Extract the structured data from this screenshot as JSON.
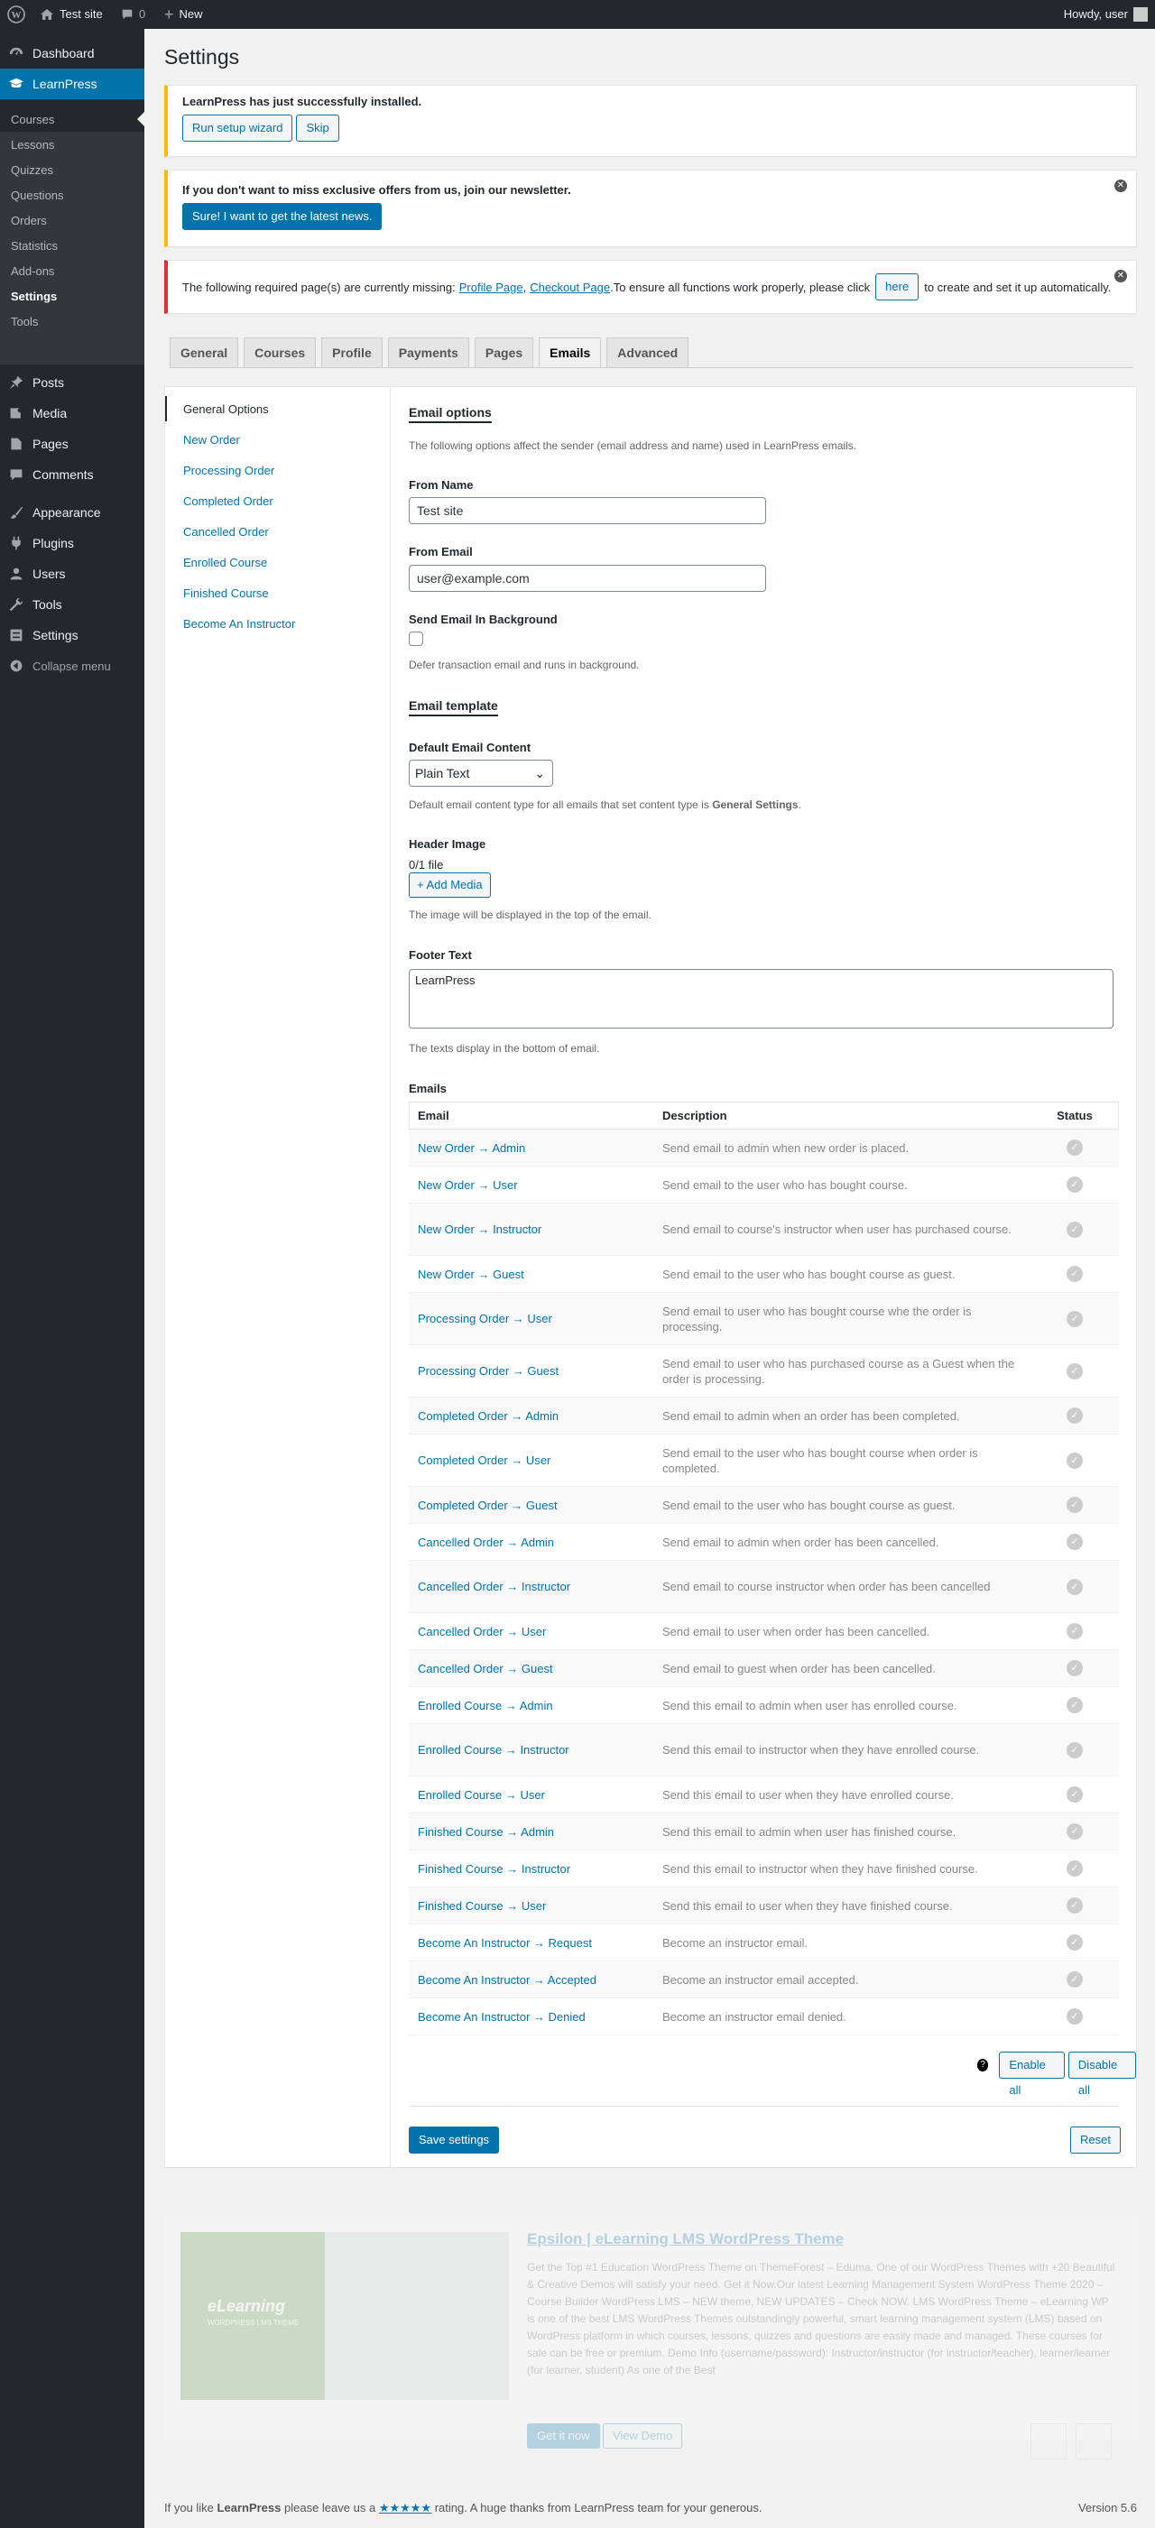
{
  "adminbar": {
    "site": "Test site",
    "comments": "0",
    "new": "New",
    "howdy": "Howdy, user"
  },
  "sidebar": {
    "top": [
      {
        "label": "Dashboard",
        "icon": "dashboard-icon"
      },
      {
        "label": "LearnPress",
        "icon": "learnpress-icon"
      }
    ],
    "learnpress_sub": [
      "Courses",
      "Lessons",
      "Quizzes",
      "Questions",
      "Orders",
      "Statistics",
      "Add-ons",
      "Settings",
      "Tools"
    ],
    "items": [
      {
        "label": "Posts",
        "icon": "pin-icon"
      },
      {
        "label": "Media",
        "icon": "media-icon"
      },
      {
        "label": "Pages",
        "icon": "page-icon"
      },
      {
        "label": "Comments",
        "icon": "comment-icon"
      },
      {
        "label": "Appearance",
        "icon": "brush-icon"
      },
      {
        "label": "Plugins",
        "icon": "plug-icon"
      },
      {
        "label": "Users",
        "icon": "user-icon"
      },
      {
        "label": "Tools",
        "icon": "wrench-icon"
      },
      {
        "label": "Settings",
        "icon": "settings-icon"
      },
      {
        "label": "Collapse menu",
        "icon": "collapse-icon"
      }
    ]
  },
  "page_title": "Settings",
  "notices": {
    "installed": {
      "text": "LearnPress has just successfully installed.",
      "btn1": "Run setup wizard",
      "btn2": "Skip"
    },
    "newsletter": {
      "text": "If you don't want to miss exclusive offers from us, join our newsletter.",
      "btn": "Sure! I want to get the latest news."
    },
    "missing": {
      "pre": "The following required page(s) are currently missing:",
      "link1": "Profile Page",
      "sep": ",",
      "link2": "Checkout Page",
      "mid": ".To ensure all functions work properly, please click",
      "btn": "here",
      "post": "to create and set it up automatically."
    }
  },
  "tabs": [
    "General",
    "Courses",
    "Profile",
    "Payments",
    "Pages",
    "Emails",
    "Advanced"
  ],
  "subnav": [
    "General Options",
    "New Order",
    "Processing Order",
    "Completed Order",
    "Cancelled Order",
    "Enrolled Course",
    "Finished Course",
    "Become An Instructor"
  ],
  "email_options": {
    "heading": "Email options",
    "desc": "The following options affect the sender (email address and name) used in LearnPress emails.",
    "from_name_label": "From Name",
    "from_name": "Test site",
    "from_email_label": "From Email",
    "from_email": "user@example.com",
    "bg_label": "Send Email In Background",
    "bg_desc": "Defer transaction email and runs in background."
  },
  "email_template": {
    "heading": "Email template",
    "content_label": "Default Email Content",
    "content_value": "Plain Text",
    "content_desc_pre": "Default email content type for all emails that set content type is",
    "content_desc_strong": "General Settings",
    "content_desc_post": ".",
    "header_label": "Header Image",
    "header_count": "0/1 file",
    "add_media": "+ Add Media",
    "header_desc": "The image will be displayed in the top of the email.",
    "footer_label": "Footer Text",
    "footer_value": "LearnPress",
    "footer_desc": "The texts display in the bottom of email."
  },
  "emails": {
    "label": "Emails",
    "columns": [
      "Email",
      "Description",
      "Status"
    ],
    "rows": [
      {
        "name": "New Order → Admin",
        "desc": "Send email to admin when new order is placed."
      },
      {
        "name": "New Order → User",
        "desc": "Send email to the user who has bought course."
      },
      {
        "name": "New Order → Instructor",
        "desc": "Send email to course's instructor when user has purchased course."
      },
      {
        "name": "New Order → Guest",
        "desc": "Send email to the user who has bought course as guest."
      },
      {
        "name": "Processing Order → User",
        "desc": "Send email to user who has bought course whe the order is processing."
      },
      {
        "name": "Processing Order → Guest",
        "desc": "Send email to user who has purchased course as a Guest when the order is processing."
      },
      {
        "name": "Completed Order → Admin",
        "desc": "Send email to admin when an order has been completed."
      },
      {
        "name": "Completed Order → User",
        "desc": "Send email to the user who has bought course when order is completed."
      },
      {
        "name": "Completed Order → Guest",
        "desc": "Send email to the user who has bought course as guest."
      },
      {
        "name": "Cancelled Order → Admin",
        "desc": "Send email to admin when order has been cancelled."
      },
      {
        "name": "Cancelled Order → Instructor",
        "desc": "Send email to course instructor when order has been cancelled"
      },
      {
        "name": "Cancelled Order → User",
        "desc": "Send email to user when order has been cancelled."
      },
      {
        "name": "Cancelled Order → Guest",
        "desc": "Send email to guest when order has been cancelled."
      },
      {
        "name": "Enrolled Course → Admin",
        "desc": "Send this email to admin when user has enrolled course."
      },
      {
        "name": "Enrolled Course → Instructor",
        "desc": "Send this email to instructor when they have enrolled course."
      },
      {
        "name": "Enrolled Course → User",
        "desc": "Send this email to user when they have enrolled course."
      },
      {
        "name": "Finished Course → Admin",
        "desc": "Send this email to admin when user has finished course."
      },
      {
        "name": "Finished Course → Instructor",
        "desc": "Send this email to instructor when they have finished course."
      },
      {
        "name": "Finished Course → User",
        "desc": "Send this email to user when they have finished course."
      },
      {
        "name": "Become An Instructor → Request",
        "desc": "Become an instructor email."
      },
      {
        "name": "Become An Instructor → Accepted",
        "desc": "Become an instructor email accepted."
      },
      {
        "name": "Become An Instructor → Denied",
        "desc": "Become an instructor email denied."
      }
    ],
    "help": "?",
    "enable_all": "Enable all",
    "disable_all": "Disable all"
  },
  "actions": {
    "save": "Save settings",
    "reset": "Reset"
  },
  "promo": {
    "title": "Epsilon | eLearning LMS WordPress Theme",
    "text": "Get the Top #1 Education WordPress Theme on ThemeForest – Eduma. One of our WordPress Themes with +20 Beautiful & Creative Demos will satisfy your need. Get it Now.Our latest Learning Management System WordPress Theme 2020 – Course Builder WordPress LMS – NEW theme, NEW UPDATES – Check NOW. LMS WordPress Theme – eLearning WP is one of the best LMS WordPress Themes outstandingly powerful, smart learning management system (LMS) based on WordPress platform in which courses, lessons, quizzes and questions are easily made and managed. These courses for sale can be free or premium. Demo Info (username/password): Instructor/instructor (for instructor/teacher), learner/learner (for learner, student) As one of the Best",
    "get": "Get it now",
    "view": "View Demo",
    "thumb_label": "eLearning",
    "thumb_sub": "WORDPRESS LMS THEME"
  },
  "footer": {
    "pre": "If you like",
    "brand": "LearnPress",
    "mid": "please leave us a",
    "stars": "★★★★★",
    "post": "rating. A huge thanks from LearnPress team for your generous.",
    "version": "Version 5.6"
  }
}
